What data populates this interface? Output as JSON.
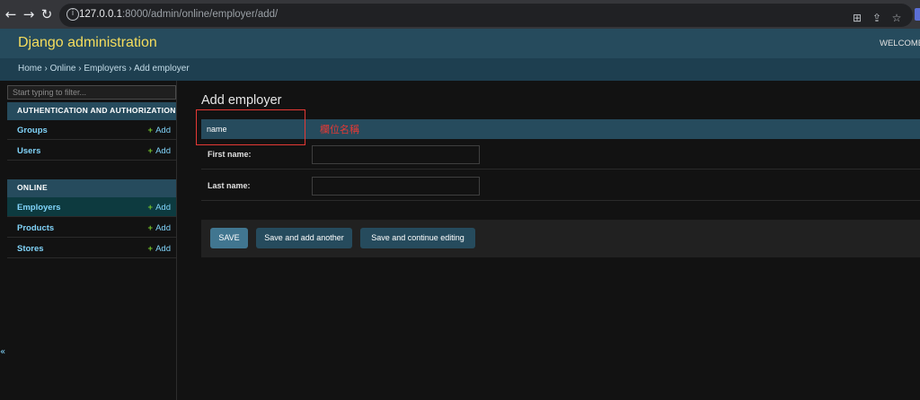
{
  "browser": {
    "url_host": "127.0.0.1",
    "url_path": ":8000/admin/online/employer/add/"
  },
  "header": {
    "brand": "Django administration",
    "welcome": "WELCOME"
  },
  "breadcrumbs": {
    "home": "Home",
    "sep1": " › ",
    "online": "Online",
    "sep2": " › ",
    "employers": "Employers",
    "sep3": " › ",
    "current": "Add employer"
  },
  "sidebar": {
    "filter_placeholder": "Start typing to filter...",
    "collapse_glyph": "«",
    "modules": [
      {
        "caption": "AUTHENTICATION AND AUTHORIZATION",
        "items": [
          {
            "label": "Groups",
            "add": "Add"
          },
          {
            "label": "Users",
            "add": "Add"
          }
        ]
      },
      {
        "caption": "ONLINE",
        "items": [
          {
            "label": "Employers",
            "add": "Add"
          },
          {
            "label": "Products",
            "add": "Add"
          },
          {
            "label": "Stores",
            "add": "Add"
          }
        ]
      }
    ]
  },
  "content": {
    "title": "Add employer",
    "fieldset_title": "name",
    "annotation": "欄位名稱",
    "fields": [
      {
        "label": "First name:",
        "value": ""
      },
      {
        "label": "Last name:",
        "value": ""
      }
    ],
    "buttons": {
      "save": "SAVE",
      "save_add_another": "Save and add another",
      "save_continue": "Save and continue editing"
    }
  },
  "colors": {
    "header_bg": "#264b5d",
    "brand": "#f5dd5d",
    "link": "#81d4fa",
    "add_plus": "#70bf2b",
    "annotation_red": "#e53935",
    "save_btn": "#417690"
  }
}
